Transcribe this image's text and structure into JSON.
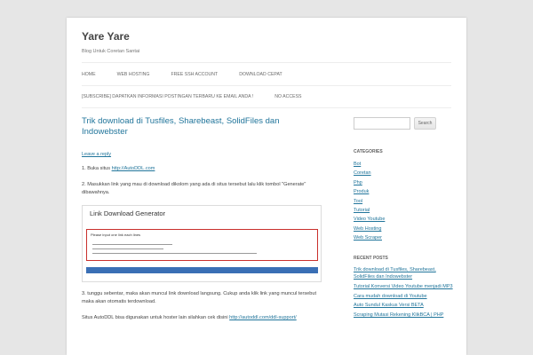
{
  "site": {
    "title": "Yare Yare",
    "description": "Blog Untuk Coretan Santai"
  },
  "nav": {
    "row1": [
      "HOME",
      "WEB HOSTING",
      "FREE SSH ACCOUNT",
      "DOWNLOAD CEPAT"
    ],
    "row2": [
      "[SUBSCRIBE] DAPATKAN INFORMASI POSTINGAN TERBARU KE EMAIL ANDA !",
      "NO ACCESS"
    ]
  },
  "post": {
    "title": "Trik download di Tusfiles, Sharebeast, SolidFiles dan Indowebster",
    "leave_reply": "Leave a reply",
    "step1_text": "1. Buka situs ",
    "step1_link": "http://AutoDDL.com",
    "step2_text": "2. Masukkan link yang mau di download dikolom yang ada di situs tersebut lalu klik tombol \"Generate\" dibawahnya.",
    "screenshot": {
      "title": "Link Download Generator",
      "input_label": "Please input one link each lines"
    },
    "step3_text": "3. tunggu sebentar, maka akan muncul link download langsung. Cukup anda klik link yang muncul tersebut maka akan otomatis terdownload.",
    "autoddl_text": "Situs AutoDDL bisa digunakan untuk hoster lain silahkan cek disini ",
    "autoddl_link": "http://autoddl.com/ddl-support/"
  },
  "sidebar": {
    "search_button": "Search",
    "categories_title": "CATEGORIES",
    "categories": [
      "Bot",
      "Coretan",
      "Php",
      "Produk",
      "Tool",
      "Tutorial",
      "Video Youtube",
      "Web Hosting",
      "Web Scraper"
    ],
    "recent_title": "RECENT POSTS",
    "recent_posts": [
      "Trik download di Tusfiles, Sharebeast, SolidFiles dan Indowebster",
      "Tutorial Konversi Video Youtube menjadi MP3",
      "Cara mudah download di Youtube",
      "Auto Sundul Kaskus Versi BETA",
      "Scraping Mutasi Rekening KlikBCA | PHP"
    ]
  }
}
